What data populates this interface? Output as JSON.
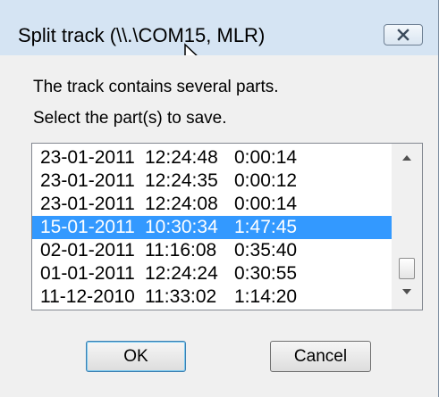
{
  "window": {
    "title": "Split track (\\\\.\\COM15, MLR)",
    "close_icon": "close-icon"
  },
  "message": {
    "line1": "The track contains several parts.",
    "line2": "Select the part(s) to save."
  },
  "track_list": {
    "rows": [
      {
        "date": "23-01-2011",
        "time": "12:24:48",
        "duration": "0:00:14",
        "selected": false
      },
      {
        "date": "23-01-2011",
        "time": "12:24:35",
        "duration": "0:00:12",
        "selected": false
      },
      {
        "date": "23-01-2011",
        "time": "12:24:08",
        "duration": "0:00:14",
        "selected": false
      },
      {
        "date": "15-01-2011",
        "time": "10:30:34",
        "duration": "1:47:45",
        "selected": true
      },
      {
        "date": "02-01-2011",
        "time": "11:16:08",
        "duration": "0:35:40",
        "selected": false
      },
      {
        "date": "01-01-2011",
        "time": "12:24:24",
        "duration": "0:30:55",
        "selected": false
      },
      {
        "date": "11-12-2010",
        "time": "11:33:02",
        "duration": "1:14:20",
        "selected": false
      }
    ]
  },
  "buttons": {
    "ok": "OK",
    "cancel": "Cancel"
  },
  "colors": {
    "selection": "#3399ff",
    "titlebar": "#d5e4f3",
    "client": "#f0f0f0"
  }
}
